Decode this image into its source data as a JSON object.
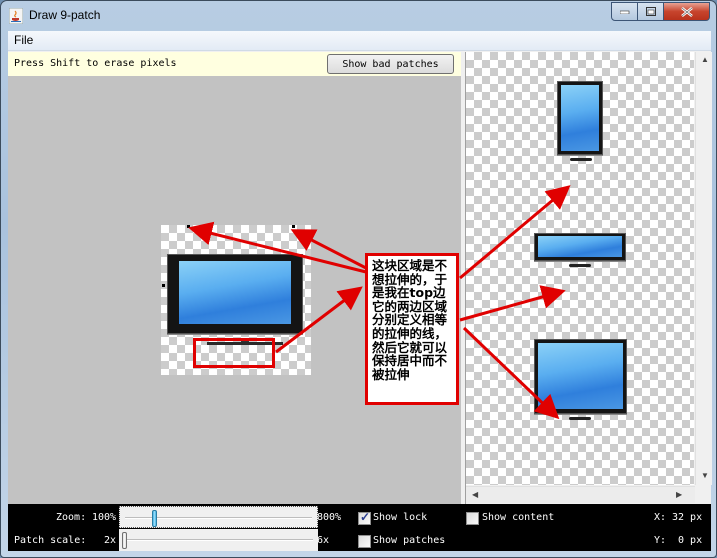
{
  "window": {
    "title": "Draw 9-patch",
    "app_icon": "java-cup-icon",
    "controls": [
      "minimize",
      "maximize",
      "close"
    ]
  },
  "menubar": {
    "items": [
      "File"
    ]
  },
  "editor": {
    "hint": "Press Shift to erase pixels",
    "show_bad_patches_label": "Show bad patches"
  },
  "annotation": {
    "text": "这块区域是不想拉伸的，于是我在top边它的两边区域分别定义相等的拉伸的线，然后它就可以保持居中而不被拉伸",
    "color": "#e00000"
  },
  "preview": {
    "items": [
      "tall-preview",
      "wide-preview",
      "large-preview"
    ]
  },
  "status": {
    "zoom_label": "Zoom:",
    "zoom_min": "100%",
    "zoom_max": "800%",
    "zoom_value_fraction": 0.06,
    "patch_scale_label": "Patch scale:",
    "patch_scale_min": "2x",
    "patch_scale_max": "6x",
    "patch_scale_value_fraction": 0.0,
    "show_lock_label": "Show lock",
    "show_lock_checked": true,
    "show_content_label": "Show content",
    "show_content_checked": false,
    "show_patches_label": "Show patches",
    "show_patches_checked": false,
    "x_label": "X:",
    "x_value": "32 px",
    "y_label": "Y:",
    "y_value": " 0 px"
  },
  "colors": {
    "hint_bg": "#ffffe0",
    "editor_bg": "#c2c2c2",
    "status_bg": "#000000",
    "annotation_red": "#e00000",
    "screen_blue": "#4a97e3"
  }
}
